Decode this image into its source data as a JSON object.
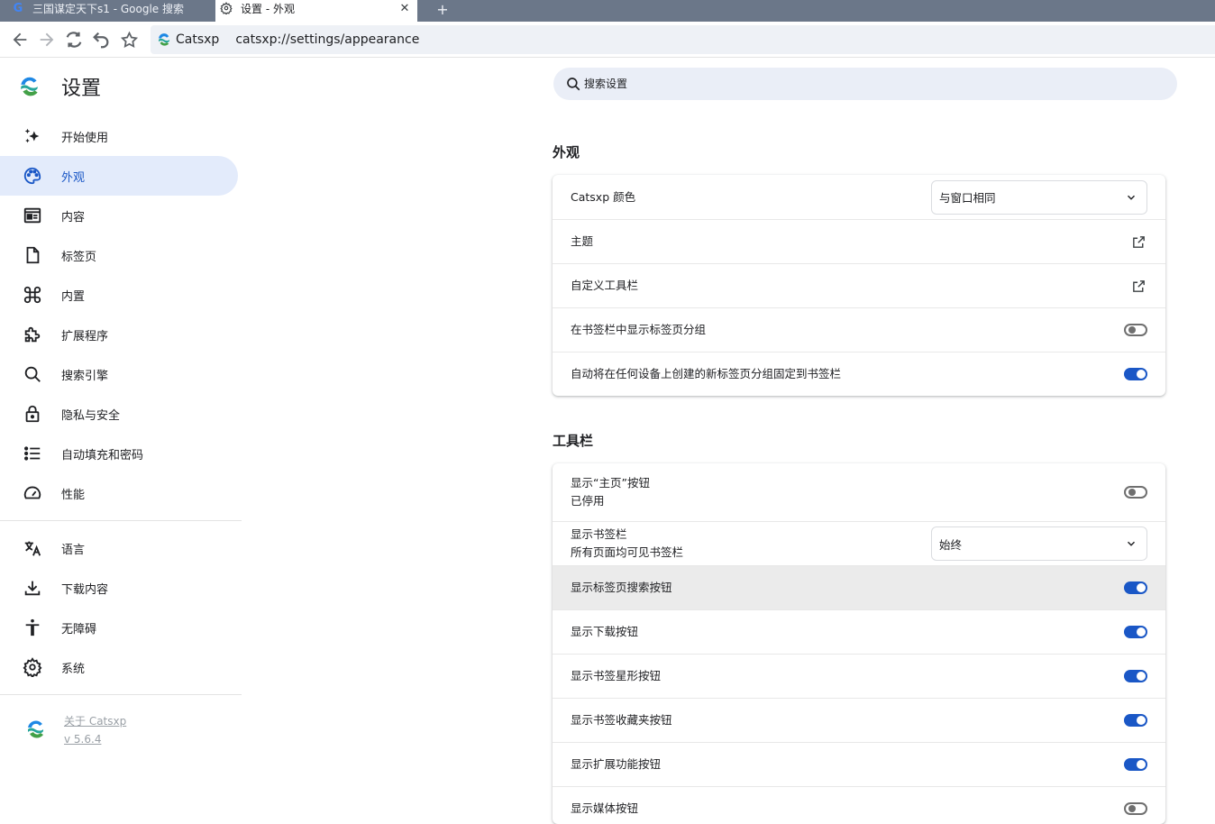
{
  "colors": {
    "accent": "#1a57c6",
    "tabstrip": "#6b7789",
    "selected_bg": "#e3ebfb"
  },
  "tabs": [
    {
      "title": "三国谋定天下s1 - Google 搜索",
      "icon": "google-icon"
    },
    {
      "title": "设置 - 外观",
      "icon": "gear-icon",
      "close": "✕"
    }
  ],
  "new_tab": "+",
  "address": {
    "site": "Catsxp",
    "url": "catsxp://settings/appearance"
  },
  "sidebar": {
    "title": "设置",
    "items": [
      {
        "label": "开始使用",
        "icon": "sparkle-icon"
      },
      {
        "label": "外观",
        "icon": "palette-icon",
        "selected": true
      },
      {
        "label": "内容",
        "icon": "newspaper-icon"
      },
      {
        "label": "标签页",
        "icon": "page-icon"
      },
      {
        "label": "内置",
        "icon": "command-icon"
      },
      {
        "label": "扩展程序",
        "icon": "puzzle-icon"
      },
      {
        "label": "搜索引擎",
        "icon": "search-icon"
      },
      {
        "label": "隐私与安全",
        "icon": "lock-icon"
      },
      {
        "label": "自动填充和密码",
        "icon": "list-icon"
      },
      {
        "label": "性能",
        "icon": "speedometer-icon"
      },
      {
        "label": "语言",
        "icon": "translate-icon"
      },
      {
        "label": "下载内容",
        "icon": "download-icon"
      },
      {
        "label": "无障碍",
        "icon": "accessibility-icon"
      },
      {
        "label": "系统",
        "icon": "gear-icon"
      }
    ],
    "about": {
      "label": "关于 Catsxp",
      "version": "v 5.6.4"
    }
  },
  "search": {
    "placeholder": "搜索设置"
  },
  "appearance": {
    "title": "外观",
    "color_label": "Catsxp 颜色",
    "color_value": "与窗口相同",
    "theme_label": "主题",
    "toolbar_customize_label": "自定义工具栏",
    "show_tab_groups_label": "在书签栏中显示标签页分组",
    "show_tab_groups_on": false,
    "pin_tab_groups_label": "自动将在任何设备上创建的新标签页分组固定到书签栏",
    "pin_tab_groups_on": true
  },
  "toolbar_section": {
    "title": "工具栏",
    "home_label": "显示“主页”按钮",
    "home_sub": "已停用",
    "home_on": false,
    "bookmarks_label": "显示书签栏",
    "bookmarks_sub": "所有页面均可见书签栏",
    "bookmarks_value": "始终",
    "items": [
      {
        "label": "显示标签页搜索按钮",
        "on": true
      },
      {
        "label": "显示下载按钮",
        "on": true
      },
      {
        "label": "显示书签星形按钮",
        "on": true
      },
      {
        "label": "显示书签收藏夹按钮",
        "on": true
      },
      {
        "label": "显示扩展功能按钮",
        "on": true
      },
      {
        "label": "显示媒体按钮",
        "on": false
      }
    ]
  }
}
